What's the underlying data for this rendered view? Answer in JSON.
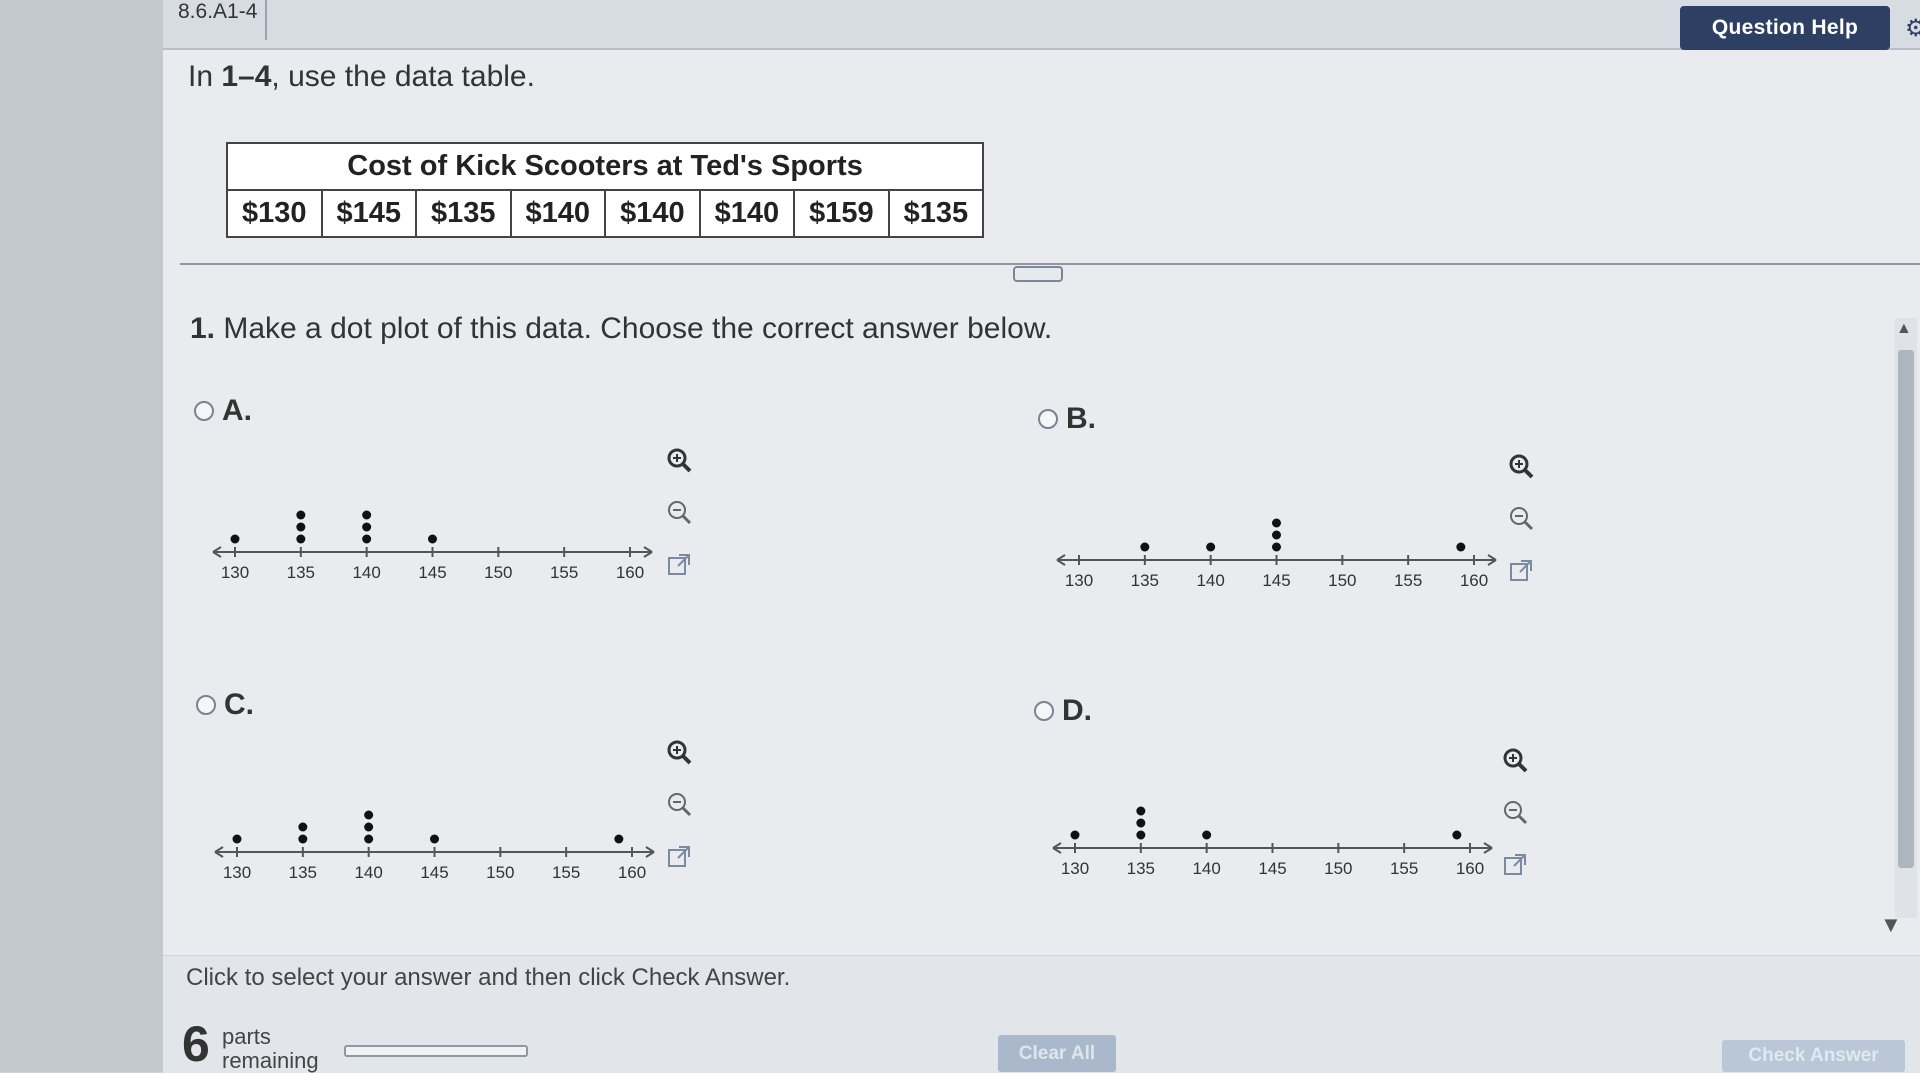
{
  "header": {
    "question_id": "8.6.A1-4",
    "help_button": "Question Help"
  },
  "instruction": {
    "prefix": "In ",
    "range": "1–4",
    "suffix": ", use the data table."
  },
  "data_table": {
    "title": "Cost of Kick Scooters at Ted's Sports",
    "values": [
      "$130",
      "$145",
      "$135",
      "$140",
      "$140",
      "$140",
      "$159",
      "$135"
    ]
  },
  "question": {
    "number": "1.",
    "text": " Make a dot plot of this data. Choose the correct answer below."
  },
  "choices": [
    {
      "label": "A.",
      "dots": [
        [
          130,
          1
        ],
        [
          135,
          3
        ],
        [
          140,
          3
        ],
        [
          145,
          1
        ]
      ]
    },
    {
      "label": "B.",
      "dots": [
        [
          135,
          1
        ],
        [
          140,
          1
        ],
        [
          145,
          3
        ],
        [
          159,
          1
        ]
      ]
    },
    {
      "label": "C.",
      "dots": [
        [
          130,
          1
        ],
        [
          135,
          2
        ],
        [
          140,
          3
        ],
        [
          145,
          1
        ],
        [
          159,
          1
        ]
      ]
    },
    {
      "label": "D.",
      "dots": [
        [
          130,
          1
        ],
        [
          135,
          3
        ],
        [
          140,
          1
        ],
        [
          159,
          1
        ]
      ]
    }
  ],
  "axis": {
    "ticks": [
      "130",
      "135",
      "140",
      "145",
      "150",
      "155",
      "160"
    ]
  },
  "tools": {
    "zoom_in": "zoom-in-icon",
    "zoom_out": "zoom-out-icon",
    "popout": "popout-icon"
  },
  "colors": {
    "header_button": "#2d3f63",
    "axis": "#555555",
    "dot": "#111111"
  },
  "footer": {
    "hint": "Click to select your answer and then click Check Answer.",
    "parts_count": "6",
    "parts_label_1": "parts",
    "parts_label_2": "remaining",
    "clear_all": "Clear All",
    "check_answer": "Check Answer"
  }
}
